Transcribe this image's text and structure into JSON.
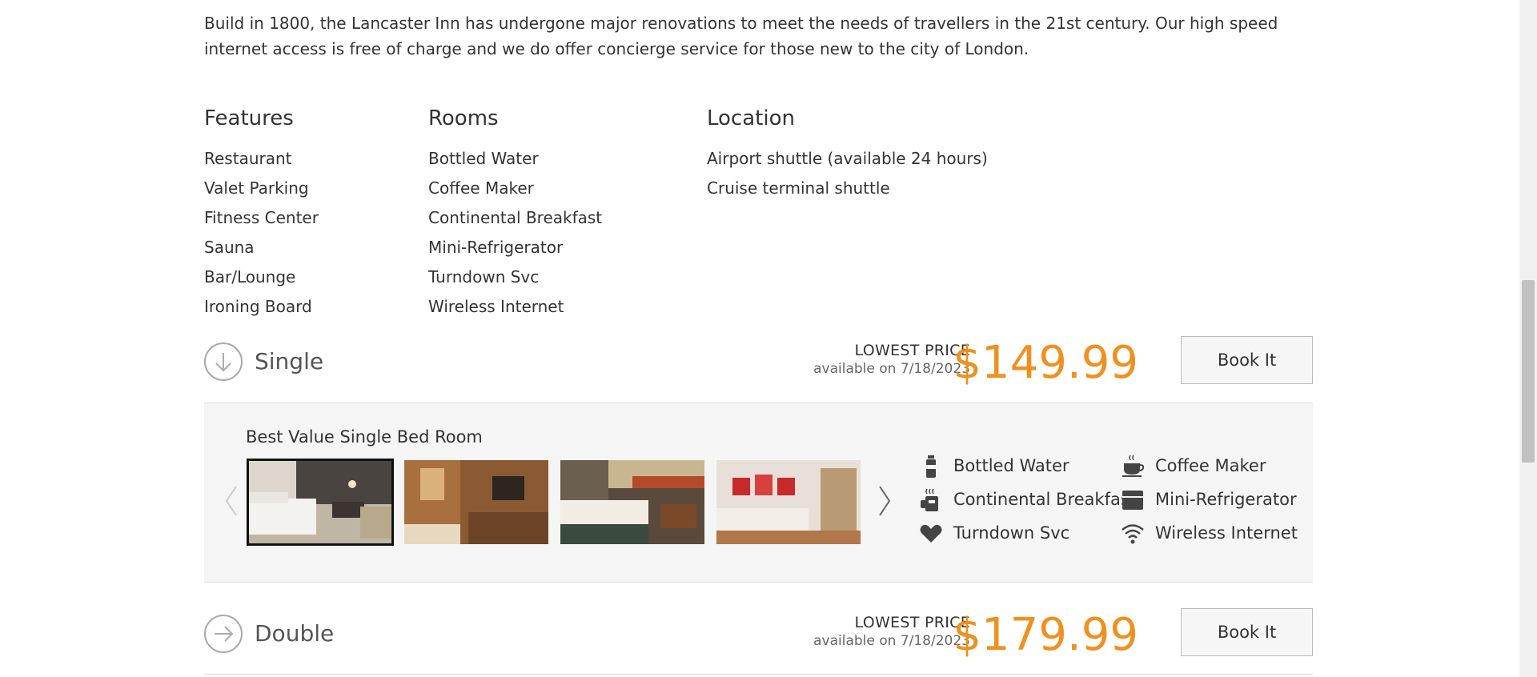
{
  "intro": "Build in 1800, the Lancaster Inn has undergone major renovations to meet the needs of travellers in the 21st century. Our high speed internet access is free of charge and we do offer concierge service for those new to the city of London.",
  "features": {
    "heading": "Features",
    "items": [
      "Restaurant",
      "Valet Parking",
      "Fitness Center",
      "Sauna",
      "Bar/Lounge",
      "Ironing Board"
    ]
  },
  "rooms": {
    "heading": "Rooms",
    "items": [
      "Bottled Water",
      "Coffee Maker",
      "Continental Breakfast",
      "Mini-Refrigerator",
      "Turndown Svc",
      "Wireless Internet"
    ]
  },
  "location": {
    "heading": "Location",
    "items": [
      "Airport shuttle (available 24 hours)",
      "Cruise terminal shuttle"
    ]
  },
  "single": {
    "name": "Single",
    "lowest_label": "LOWEST PRICE",
    "available": "available on 7/18/2023",
    "price": "$149.99",
    "book_label": "Book It",
    "detail_title": "Best Value Single Bed Room",
    "amenities": [
      {
        "label": "Bottled Water",
        "icon": "bottle-icon"
      },
      {
        "label": "Coffee Maker",
        "icon": "coffee-cup-icon"
      },
      {
        "label": "Continental Breakfast",
        "icon": "breakfast-icon"
      },
      {
        "label": "Mini-Refrigerator",
        "icon": "fridge-icon"
      },
      {
        "label": "Turndown Svc",
        "icon": "heart-icon"
      },
      {
        "label": "Wireless Internet",
        "icon": "wifi-icon"
      }
    ]
  },
  "double": {
    "name": "Double",
    "lowest_label": "LOWEST PRICE",
    "available": "available on 7/18/2023",
    "price": "$179.99",
    "book_label": "Book It"
  },
  "colors": {
    "price": "#f0901e",
    "text": "#333333",
    "panel": "#f5f5f5"
  }
}
